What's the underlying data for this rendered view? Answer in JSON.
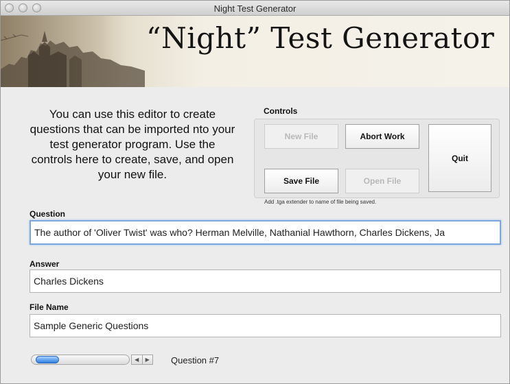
{
  "window": {
    "title": "Night Test Generator"
  },
  "banner": {
    "title": "“Night” Test Generator"
  },
  "intro": {
    "text": "You can use this editor to create questions that can be imported nto your test generator program. Use the controls here to create, save, and open your new file."
  },
  "controls": {
    "label": "Controls",
    "new_file": "New File",
    "abort_work": "Abort Work",
    "quit": "Quit",
    "save_file": "Save File",
    "open_file": "Open File",
    "hint": "Add .tga extender to name of file being saved."
  },
  "fields": {
    "question": {
      "label": "Question",
      "value": "The author of 'Oliver Twist' was who? Herman Melville, Nathanial Hawthorn, Charles Dickens, Ja"
    },
    "answer": {
      "label": "Answer",
      "value": "Charles Dickens"
    },
    "file_name": {
      "label": "File Name",
      "value": "Sample Generic Questions"
    }
  },
  "navigator": {
    "question_label": "Question #7",
    "left_arrow_icon": "arrow-left-icon",
    "right_arrow_icon": "arrow-right-icon"
  }
}
